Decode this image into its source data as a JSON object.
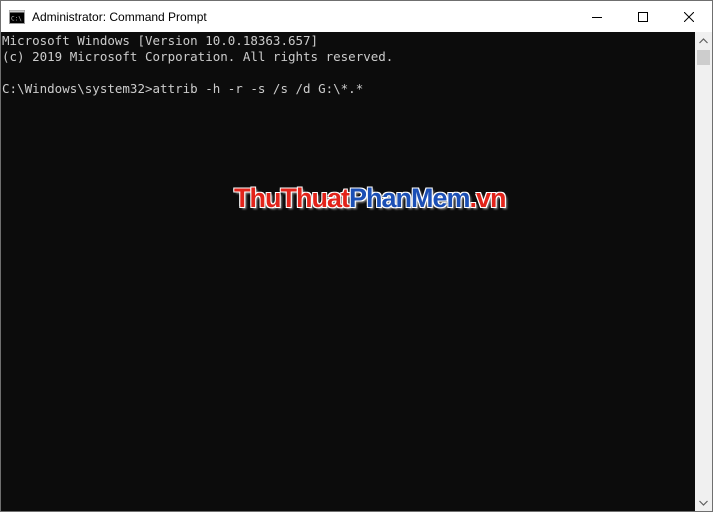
{
  "window": {
    "title": "Administrator: Command Prompt",
    "icon": "cmd-icon",
    "controls": [
      "minimize-icon",
      "maximize-icon",
      "close-icon"
    ]
  },
  "console": {
    "lines": [
      "Microsoft Windows [Version 10.0.18363.657]",
      "(c) 2019 Microsoft Corporation. All rights reserved.",
      "",
      "C:\\Windows\\system32>attrib -h -r -s /s /d G:\\*.*"
    ],
    "background_color": "#0c0c0c",
    "text_color": "#cccccc"
  },
  "watermark": {
    "part1": "ThuThuat",
    "part2": "PhanMem",
    "part3": ".vn",
    "color_red": "#e2231a",
    "color_blue": "#1b4fb5"
  }
}
